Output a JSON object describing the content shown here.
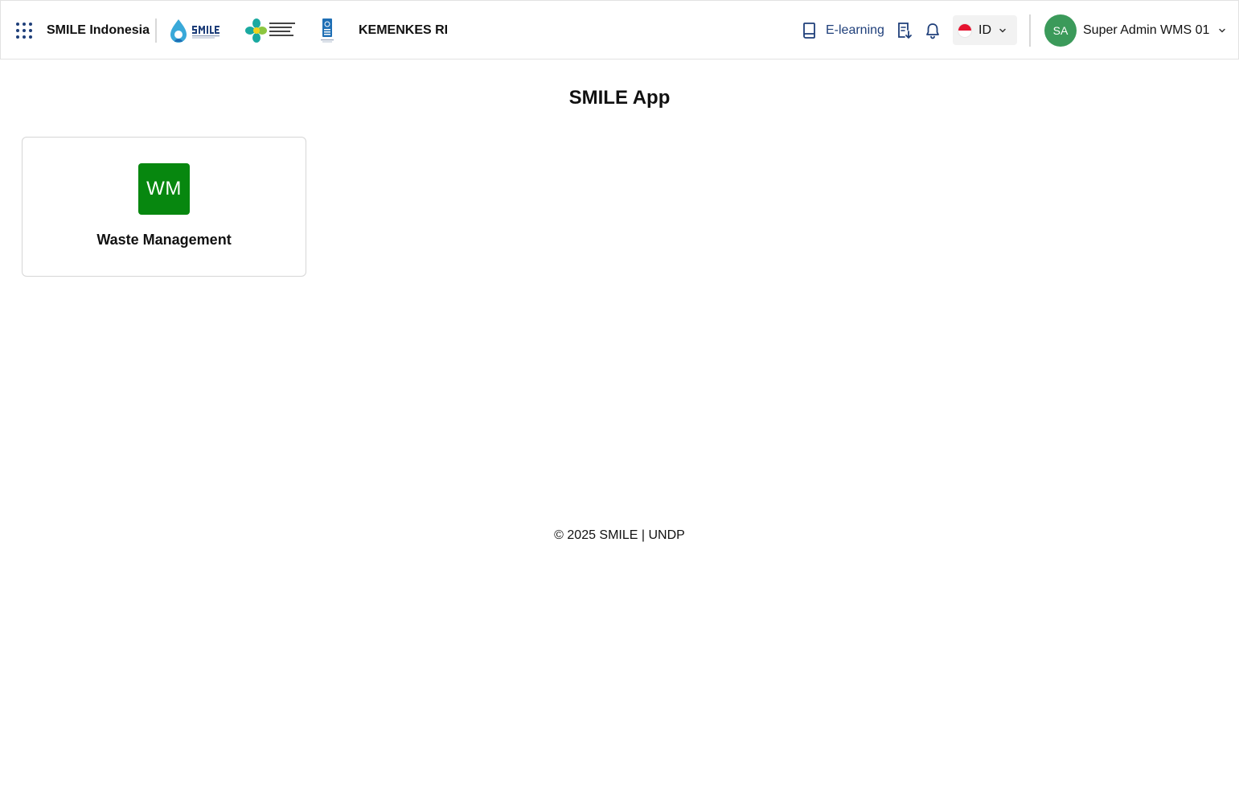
{
  "header": {
    "app_name": "SMILE Indonesia",
    "org_name": "KEMENKES RI",
    "elearning_label": "E-learning",
    "language": {
      "code": "ID"
    },
    "user": {
      "initials": "SA",
      "name": "Super Admin WMS 01"
    }
  },
  "main": {
    "title": "SMILE App",
    "apps": [
      {
        "initials": "WM",
        "label": "Waste Management",
        "tile_color": "#07870F"
      }
    ]
  },
  "footer": {
    "text": "© 2025 SMILE | UNDP"
  },
  "colors": {
    "brand_navy": "#1F3F7A",
    "avatar_green": "#3B9A5A"
  },
  "icons": {
    "app_launcher": "grid-dots-icon",
    "elearning": "book-icon",
    "downloads": "document-download-icon",
    "notifications": "bell-icon",
    "dropdown": "chevron-down-icon"
  }
}
